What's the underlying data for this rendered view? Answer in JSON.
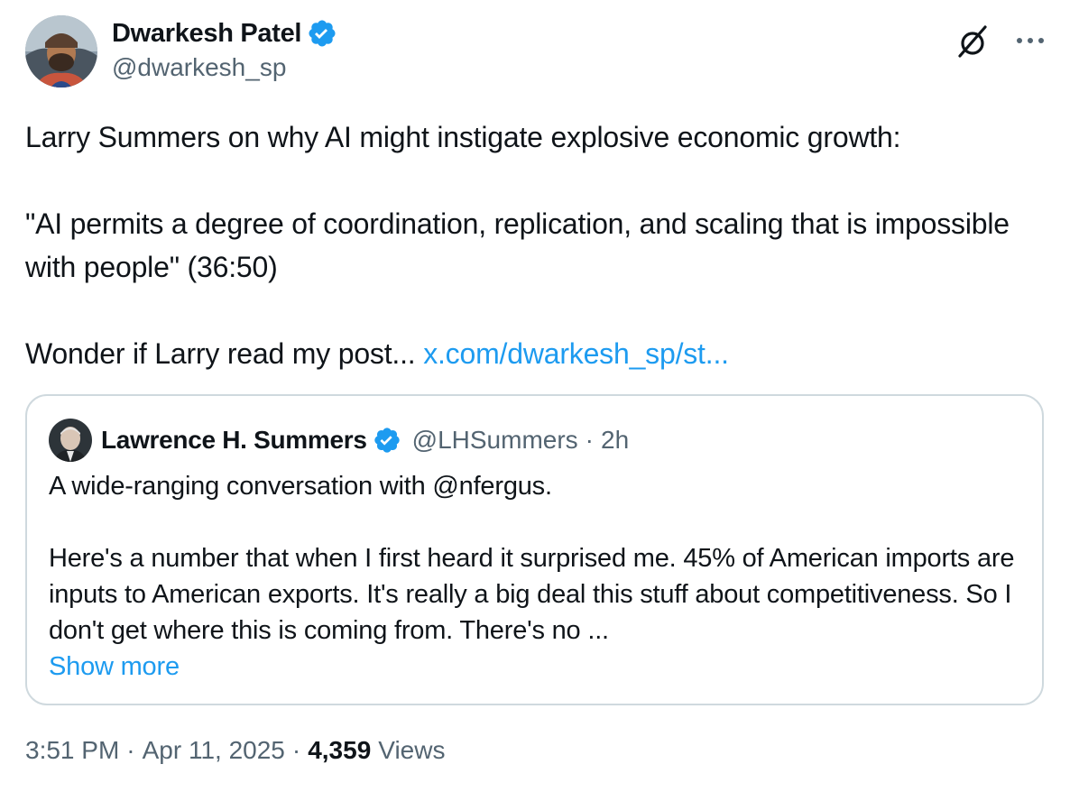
{
  "author": {
    "name": "Dwarkesh Patel",
    "handle": "@dwarkesh_sp"
  },
  "tweet": {
    "line1": "Larry Summers on why AI might instigate explosive economic growth:",
    "line2": "\"AI permits a degree of coordination, replication, and scaling that is impossible with people\" (36:50)",
    "line3_prefix": "Wonder if Larry read my post... ",
    "line3_link": "x.com/dwarkesh_sp/st..."
  },
  "quote": {
    "name": "Lawrence H. Summers",
    "handle": "@LHSummers",
    "separator": "·",
    "time": "2h",
    "para1": "A wide-ranging conversation with @nfergus.",
    "para2": "Here's a number that when I first heard it surprised me. 45% of American imports are inputs to American exports. It's really a big deal this stuff about competitiveness. So I don't get where this is coming from. There's no ...",
    "show_more": "Show more"
  },
  "meta": {
    "time": "3:51 PM",
    "sep1": "·",
    "date": "Apr 11, 2025",
    "sep2": "·",
    "views_count": "4,359",
    "views_label": "Views"
  },
  "icons": {
    "verified": "verified-badge-icon",
    "grok": "grok-icon",
    "more": "more-icon"
  },
  "colors": {
    "link": "#1d9bf0",
    "secondary": "#536471",
    "border": "#cfd9de",
    "verified": "#1d9bf0"
  }
}
